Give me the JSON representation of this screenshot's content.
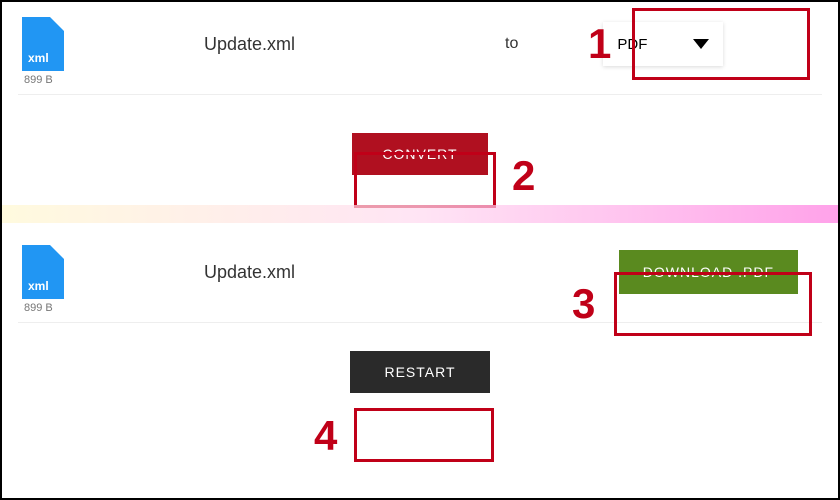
{
  "file1": {
    "icon_label": "xml",
    "name": "Update.xml",
    "size": "899 B",
    "to_label": "to"
  },
  "format_select": {
    "selected": "PDF"
  },
  "convert_button": "CONVERT",
  "file2": {
    "icon_label": "xml",
    "name": "Update.xml",
    "size": "899 B"
  },
  "download_button": "DOWNLOAD .PDF",
  "restart_button": "RESTART",
  "steps": {
    "s1": "1",
    "s2": "2",
    "s3": "3",
    "s4": "4"
  }
}
